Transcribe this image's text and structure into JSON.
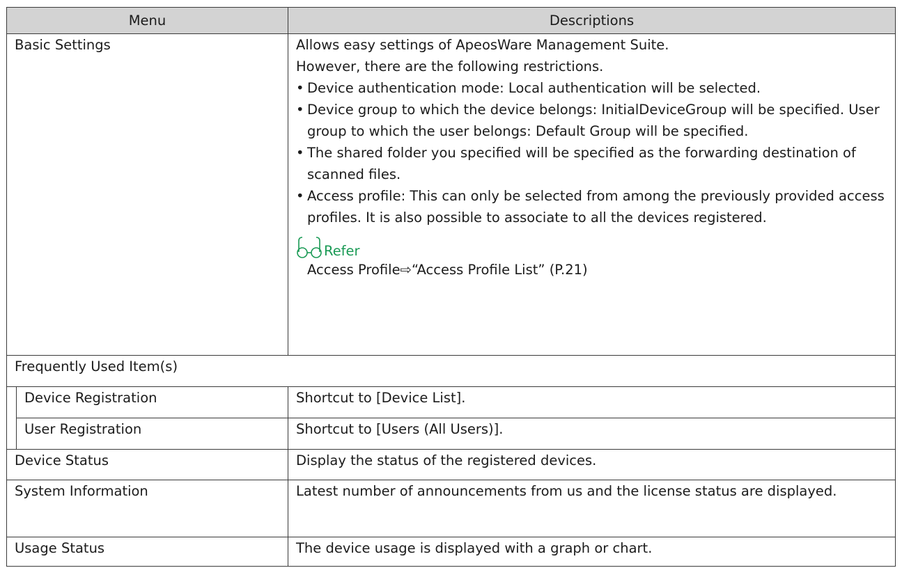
{
  "header": {
    "menu": "Menu",
    "descriptions": "Descriptions"
  },
  "basic": {
    "menu": "Basic Settings",
    "line1": "Allows easy settings of ApeosWare Management Suite.",
    "line2": "However, there are the following restrictions.",
    "bullet_char": "•",
    "bullets": [
      "Device authentication mode: Local authentication will be selected.",
      "Device group to which the device belongs: InitialDeviceGroup will be specified. User group to which the user belongs: Default Group will be specified.",
      "The shared folder you specified will be specified as the forwarding destination of scanned files.",
      "Access profile: This can only be selected from among the previously provided access profiles. It is also possible to associate to all the devices registered."
    ],
    "refer_label": "Refer",
    "refer_text": "Access Profile⇨“Access Profile List” (P.21)"
  },
  "frequent": {
    "group": "Frequently Used Item(s)",
    "items": [
      {
        "menu": "Device Registration",
        "desc": "Shortcut to [Device List]."
      },
      {
        "menu": "User Registration",
        "desc": "Shortcut to [Users (All Users)]."
      }
    ]
  },
  "rows": [
    {
      "menu": "Device Status",
      "desc": "Display the status of the registered devices."
    },
    {
      "menu": "System Information",
      "desc": "Latest number of announcements from us and the license status are displayed."
    },
    {
      "menu": "Usage Status",
      "desc": "The device usage is displayed with a graph or chart."
    }
  ],
  "colors": {
    "header_bg": "#d3d3d3",
    "refer_accent": "#1a9a55",
    "border": "#3a3a3a"
  },
  "icons": {
    "refer": "glasses-icon"
  }
}
